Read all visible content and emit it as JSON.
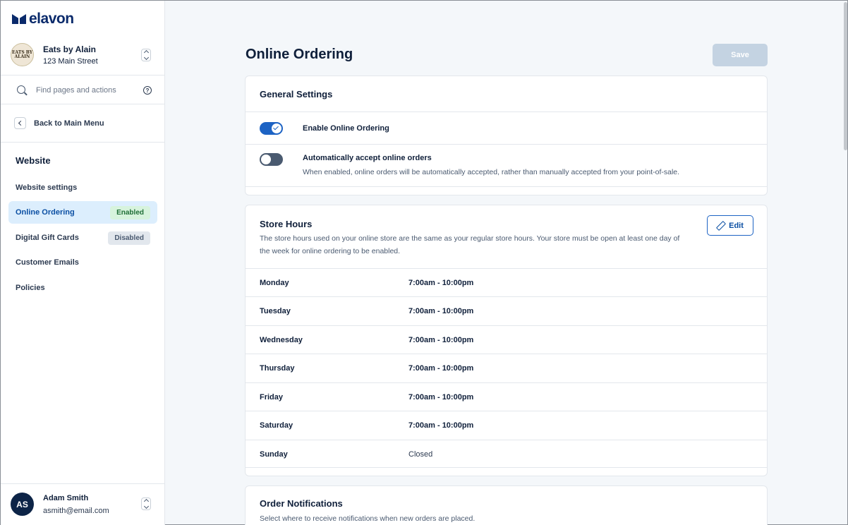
{
  "brand": {
    "name": "elavon"
  },
  "store": {
    "name": "Eats by Alain",
    "address": "123 Main Street",
    "logo_text_1": "EATS BY",
    "logo_text_2": "ALAIN"
  },
  "search": {
    "placeholder": "Find pages and actions"
  },
  "back": {
    "label": "Back to Main Menu"
  },
  "sidebar": {
    "section": "Website",
    "items": [
      {
        "label": "Website settings",
        "badge": ""
      },
      {
        "label": "Online Ordering",
        "badge": "Enabled"
      },
      {
        "label": "Digital Gift Cards",
        "badge": "Disabled"
      },
      {
        "label": "Customer Emails",
        "badge": ""
      },
      {
        "label": "Policies",
        "badge": ""
      }
    ]
  },
  "user": {
    "initials": "AS",
    "name": "Adam Smith",
    "email": "asmith@email.com"
  },
  "page": {
    "title": "Online Ordering",
    "save_label": "Save"
  },
  "general": {
    "title": "General Settings",
    "settings": [
      {
        "label": "Enable Online Ordering",
        "enabled": true,
        "description": ""
      },
      {
        "label": "Automatically accept online orders",
        "enabled": false,
        "description": "When enabled, online orders will be automatically accepted, rather than manually accepted from your point-of-sale."
      }
    ]
  },
  "hours": {
    "title": "Store Hours",
    "description": "The store hours used on your online store are the same as your regular store hours. Your store must be open at least one day of the week for online ordering to be enabled.",
    "edit_label": "Edit",
    "rows": [
      {
        "day": "Monday",
        "time": "7:00am - 10:00pm"
      },
      {
        "day": "Tuesday",
        "time": "7:00am - 10:00pm"
      },
      {
        "day": "Wednesday",
        "time": "7:00am - 10:00pm"
      },
      {
        "day": "Thursday",
        "time": "7:00am - 10:00pm"
      },
      {
        "day": "Friday",
        "time": "7:00am - 10:00pm"
      },
      {
        "day": "Saturday",
        "time": "7:00am - 10:00pm"
      },
      {
        "day": "Sunday",
        "time": "Closed"
      }
    ]
  },
  "notifications": {
    "title": "Order Notifications",
    "description": "Select where to receive notifications when new orders are placed."
  },
  "colors": {
    "accent": "#1d63c4",
    "navy": "#0d2447",
    "enabled_badge": "#d7f3dd",
    "disabled_badge": "#e2e7ed"
  }
}
